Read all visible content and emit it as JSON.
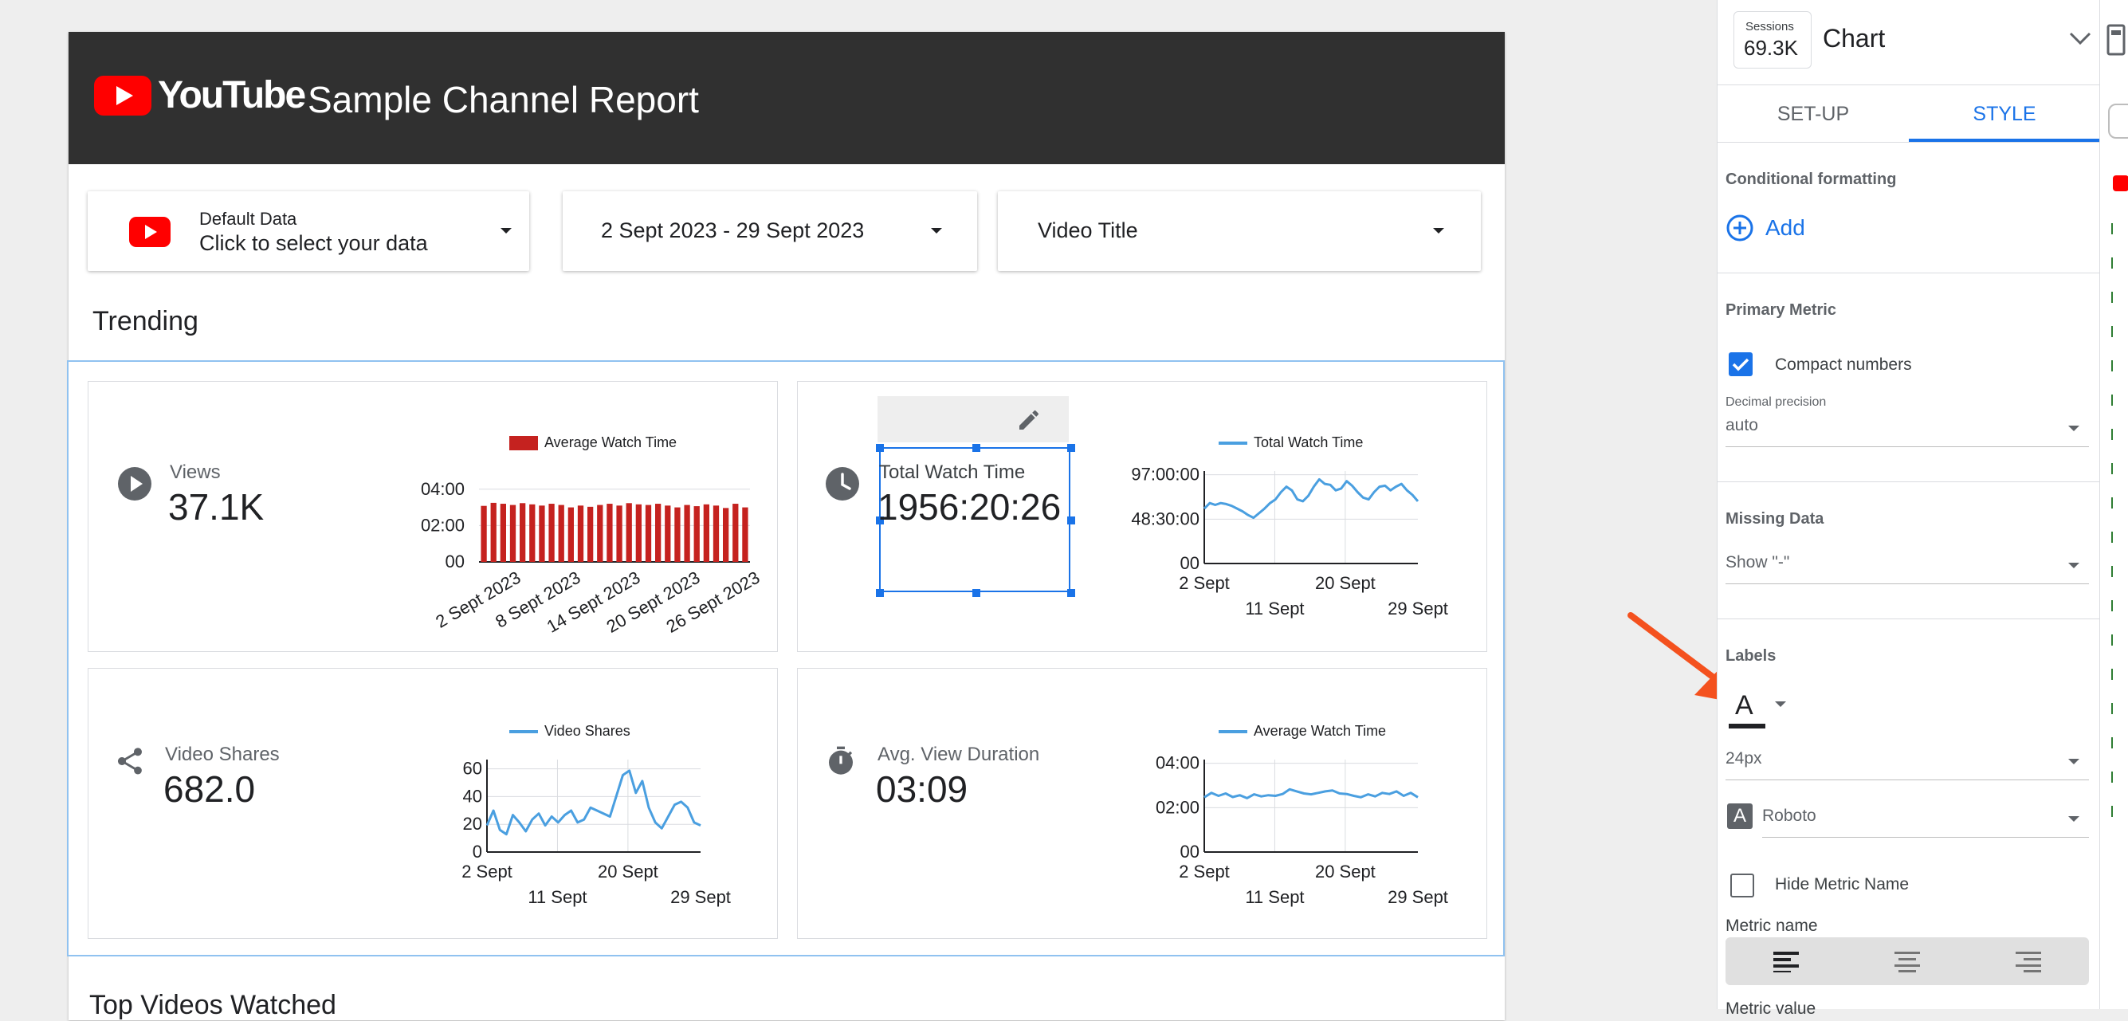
{
  "report": {
    "brand": "YouTube",
    "title": "Sample Channel Report",
    "controls": {
      "data_source_title": "Default Data",
      "data_source_subtitle": "Click to select your data",
      "date_range": "2 Sept 2023 - 29 Sept 2023",
      "video_filter": "Video Title"
    },
    "trending_title": "Trending",
    "top_videos_title": "Top Videos Watched"
  },
  "scorecards": [
    {
      "label": "Views",
      "value": "37.1K",
      "icon": "play-circle-icon",
      "legend": "Average Watch Time"
    },
    {
      "label": "Total Watch Time",
      "value": "1956:20:26",
      "icon": "clock-icon",
      "legend": "Total Watch Time"
    },
    {
      "label": "Video Shares",
      "value": "682.0",
      "icon": "share-icon",
      "legend": "Video Shares"
    },
    {
      "label": "Avg. View Duration",
      "value": "03:09",
      "icon": "stopwatch-icon",
      "legend": "Average Watch Time"
    }
  ],
  "chart_data": [
    {
      "type": "bar",
      "legend": "Average Watch Time",
      "color": "#c5221f",
      "yticks": [
        "00",
        "02:00",
        "04:00"
      ],
      "ylim": [
        0,
        300
      ],
      "xticks": [
        "2 Sept 2023",
        "8 Sept 2023",
        "14 Sept 2023",
        "20 Sept 2023",
        "26 Sept 2023"
      ],
      "values": [
        185,
        195,
        192,
        188,
        194,
        190,
        186,
        192,
        188,
        180,
        186,
        182,
        188,
        192,
        186,
        194,
        190,
        188,
        192,
        186,
        180,
        188,
        184,
        190,
        186,
        178,
        192,
        180
      ]
    },
    {
      "type": "line",
      "legend": "Total Watch Time",
      "color": "#4a9fe0",
      "yticks": [
        "00",
        "48:30:00",
        "97:00:00"
      ],
      "ylim": [
        0,
        97
      ],
      "xticks_row1": [
        "2 Sept",
        "20 Sept"
      ],
      "xticks_row2": [
        "11 Sept",
        "29 Sept"
      ],
      "values": [
        60,
        66,
        64,
        66,
        65,
        63,
        60,
        57,
        53,
        50,
        55,
        60,
        66,
        70,
        78,
        84,
        80,
        70,
        68,
        74,
        84,
        92,
        87,
        86,
        80,
        82,
        90,
        85,
        78,
        72,
        70,
        78,
        84,
        85,
        80,
        84,
        87,
        80,
        75,
        68
      ]
    },
    {
      "type": "line",
      "legend": "Video Shares",
      "color": "#4a9fe0",
      "yticks": [
        "0",
        "20",
        "40",
        "60"
      ],
      "ylim": [
        0,
        60
      ],
      "xticks_row1": [
        "2 Sept",
        "20 Sept"
      ],
      "xticks_row2": [
        "11 Sept",
        "29 Sept"
      ],
      "values": [
        18,
        28,
        15,
        12,
        25,
        20,
        14,
        22,
        26,
        18,
        24,
        20,
        25,
        28,
        20,
        22,
        30,
        28,
        26,
        24,
        38,
        52,
        55,
        40,
        48,
        30,
        20,
        16,
        24,
        32,
        34,
        30,
        20,
        18
      ]
    },
    {
      "type": "line",
      "legend": "Average Watch Time",
      "color": "#4a9fe0",
      "yticks": [
        "00",
        "02:00",
        "04:00"
      ],
      "ylim": [
        0,
        300
      ],
      "xticks_row1": [
        "2 Sept",
        "20 Sept"
      ],
      "xticks_row2": [
        "11 Sept",
        "29 Sept"
      ],
      "values": [
        185,
        200,
        190,
        198,
        186,
        192,
        182,
        195,
        188,
        192,
        190,
        196,
        212,
        205,
        198,
        195,
        200,
        205,
        208,
        198,
        196,
        190,
        185,
        195,
        188,
        200,
        196,
        205,
        190,
        200,
        185
      ]
    }
  ],
  "panel": {
    "sessions_label": "Sessions",
    "sessions_value": "69.3K",
    "chart_type": "Chart",
    "tabs": [
      "SET-UP",
      "STYLE"
    ],
    "active_tab": "STYLE",
    "accent": "#1a73e8",
    "conditional_formatting": {
      "title": "Conditional formatting",
      "add_label": "Add"
    },
    "primary_metric": {
      "title": "Primary Metric",
      "compact_numbers_label": "Compact numbers",
      "compact_numbers_checked": true,
      "decimal_precision_label": "Decimal precision",
      "decimal_precision_value": "auto"
    },
    "missing_data": {
      "title": "Missing Data",
      "value": "Show \"-\""
    },
    "labels": {
      "title": "Labels",
      "font_color_glyph": "A",
      "font_size": "24px",
      "font_family": "Roboto",
      "hide_metric_name_label": "Hide Metric Name",
      "metric_name_label": "Metric name",
      "metric_value_label": "Metric value"
    }
  },
  "annotation": {
    "arrow_color": "#f4511e"
  }
}
